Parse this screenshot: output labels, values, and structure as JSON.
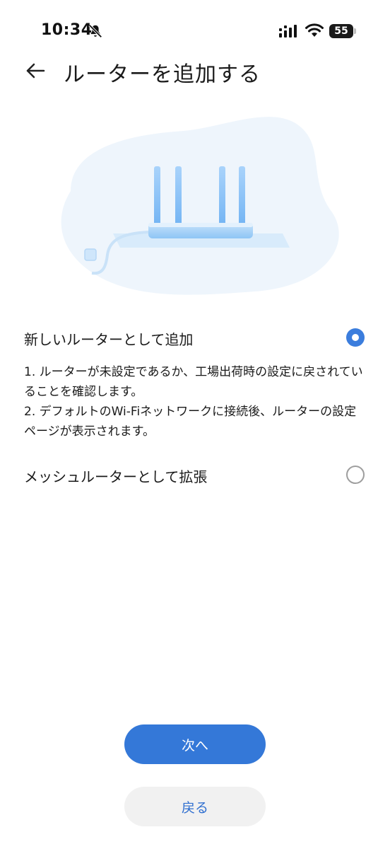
{
  "status_bar": {
    "time": "10:34",
    "battery": "55",
    "icons": [
      "bell-off-icon",
      "signal-icon",
      "wifi-icon",
      "battery-icon"
    ]
  },
  "header": {
    "title": "ルーターを追加する",
    "back_icon": "arrow-left-icon"
  },
  "illustration": {
    "icon": "router-illustration"
  },
  "options": [
    {
      "label": "新しいルーターとして追加",
      "selected": true,
      "description": [
        "1. ルーターが未設定であるか、工場出荷時の設定に戻されていることを確認します。",
        "2. デフォルトのWi-Fiネットワークに接続後、ルーターの設定ページが表示されます。"
      ]
    },
    {
      "label": "メッシュルーターとして拡張",
      "selected": false
    }
  ],
  "buttons": {
    "next": "次へ",
    "back": "戻る"
  },
  "colors": {
    "accent": "#3478d8",
    "secondary_button_bg": "#f1f1f1",
    "illustration_bg": "#eef5fc"
  }
}
